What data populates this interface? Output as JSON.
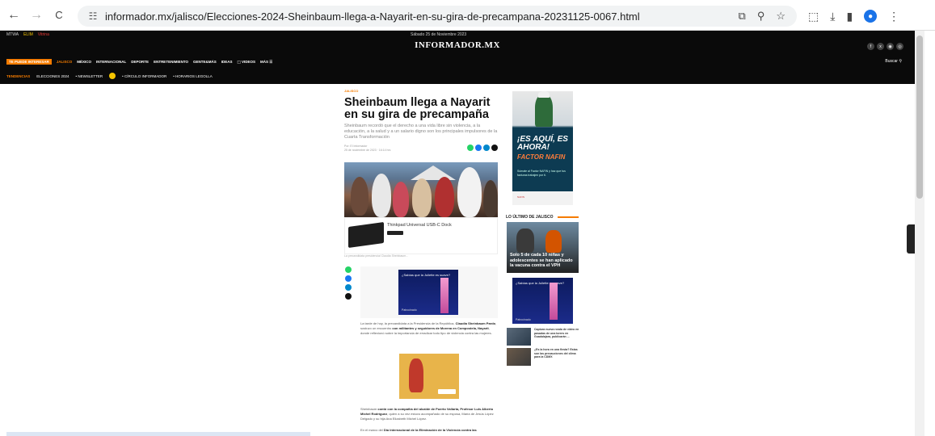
{
  "browser": {
    "url": "informador.mx/jalisco/Elecciones-2024-Sheinbaum-llega-a-Nayarit-en-su-gira-de-precampana-20231125-0067.html",
    "back_icon": "←",
    "forward_icon": "→",
    "reload_icon": "C",
    "site_info_icon": "☷",
    "cast_icon": "⧉",
    "zoom_icon": "⚲",
    "star_icon": "☆",
    "extensions_icon": "⬚",
    "download_icon": "⤓",
    "sidepanel_icon": "▮",
    "menu_icon": "⋮"
  },
  "header": {
    "top_left": [
      "MTWA",
      "ELIM",
      "Vitrina"
    ],
    "date": "Sábado 25 de Noviembre 2023",
    "logo": "INFORMADOR.MX",
    "social": [
      "f",
      "x",
      "◉",
      "◎"
    ],
    "nav": {
      "pill": "TE PUEDE INTERESAR",
      "active": "JALISCO",
      "items": [
        "MÉXICO",
        "INTERNACIONAL",
        "DEPORTE",
        "ENTRETENIMIENTO",
        "GENTE&MÁS",
        "IDEAS",
        "⬚ VIDEOS",
        "MÁS ☰"
      ],
      "search": "Buscar ⚲"
    },
    "subnav": {
      "label": "TENDENCIAS",
      "items": [
        "ELECCIONES 2024",
        "• NEWSLETTER",
        "• CÍRCULO INFORMADOR",
        "• HORARIOS LEGOLLA"
      ]
    }
  },
  "article": {
    "section": "JALISCO",
    "headline": "Sheinbaum llega a Nayarit en su gira de precampaña",
    "dek": "Sheinbaum recordó que el derecho a una vida libre sin violencia, a la educación, a la salud y a un salario digno son los principales impulsores de la Cuarta Transformación",
    "byline": "Por: El Informador",
    "dateline": "25 de noviembre de 2023 · 16:14 hrs",
    "ad_title": "Thinkpad Universal USB-C Dock",
    "caption": "La precandidata presidencial Claudia Sheinbaum...",
    "inline_ad_text": "¿Sabías que la Juliette es suave?",
    "inline_ad_foot": "Patrocinado",
    "para1_a": "La tarde de hoy, la precandidata a la Presidencia de la República, ",
    "para1_b": "Claudia Sheinbaum Pardo",
    "para1_c": ", sostuvo un encuentro ",
    "para1_d": "con militantes y seguidores de Morena en Compostela, Nayarit",
    "para1_e": ", donde reflexionó sobre la importancia de erradicar todo tipo de violencia contra las mujeres.",
    "para2_a": "Sheinbaum ",
    "para2_b": "contó con la compañía del alcalde de Puerto Vallarta, Profesor Luis Alberto Michel Rodríguez",
    "para2_c": ", quien a su vez estuvo acompañado de su esposa, María de Jesús López Delgado y su hija Ana Elizabeth Michel López.",
    "para3_a": "En el marco del ",
    "para3_b": "Día Internacional de la Eliminación de la Violencia contra las"
  },
  "sidebar": {
    "ad_headline": "¡ES AQUÍ, ES AHORA!",
    "ad_sub": "FACTOR NAFIN",
    "ad_small": "Súmate al Factor NAFIN y haz que tus facturas trabajen por ti.",
    "ad_logos": "NAFIN",
    "latest_title": "LO ÚLTIMO DE JALISCO",
    "feature_title": "Solo 5 de cada 10 niñas y adolescentes se han aplicado la vacuna contra el VPH",
    "ad2_text": "¿Sabías que la Juliette es suave?",
    "ad2_foot": "Patrocinado",
    "news": [
      "Captura nueva ronda de video en pasadas de una torres en Guadalajara, publicarán ...",
      "¿Es la hora en una fiesta? Estas son las precauciones del clima para la CDMX"
    ]
  },
  "colors": {
    "accent": "#f57c00",
    "header_bg": "#0a0a0a",
    "whatsapp": "#25d366",
    "facebook": "#1877f2",
    "telegram": "#0088cc"
  }
}
